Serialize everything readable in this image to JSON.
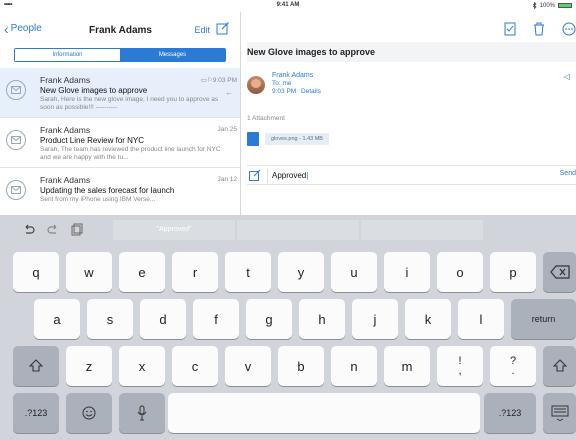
{
  "status": {
    "signal": "•••••",
    "time": "9:41 AM",
    "battery": "100%"
  },
  "left": {
    "back_label": "People",
    "title": "Frank Adams",
    "edit_label": "Edit",
    "segments": [
      "Information",
      "Messages"
    ],
    "messages": [
      {
        "from": "Frank Adams",
        "date": "9:03 PM",
        "subject": "New Glove images to approve",
        "preview": "Sarah, Here is the new glove image, I need you to approve as soon as possible!!! ----------"
      },
      {
        "from": "Frank Adams",
        "date": "Jan 25",
        "subject": "Product Line Review for NYC",
        "preview": "Sarah, The team has reviewed the product line launch for NYC and we are happy with the tu..."
      },
      {
        "from": "Frank Adams",
        "date": "Jan 12",
        "subject": "Updating the sales forecast for launch",
        "preview": "Sent from my iPhone using IBM Verse..."
      }
    ]
  },
  "right": {
    "subject": "New Glove images to approve",
    "sender_name": "Frank Adams",
    "to": "To: me",
    "time": "9:03 PM",
    "details_label": "Details",
    "attachment_label": "1 Attachment",
    "attachment_name": "gloves.png - 1.43 MB",
    "reply_text": "Approved",
    "send_label": "Send"
  },
  "keyboard": {
    "suggestions": [
      "\"Approved\"",
      "",
      ""
    ],
    "row1": [
      "q",
      "w",
      "e",
      "r",
      "t",
      "y",
      "u",
      "i",
      "o",
      "p"
    ],
    "row2": [
      "a",
      "s",
      "d",
      "f",
      "g",
      "h",
      "j",
      "k",
      "l"
    ],
    "row3": [
      "z",
      "x",
      "c",
      "v",
      "b",
      "n",
      "m"
    ],
    "punct1": [
      "!",
      ","
    ],
    "punct2": [
      "?",
      "."
    ],
    "return_label": "return",
    "numbers_label": ".?123"
  }
}
